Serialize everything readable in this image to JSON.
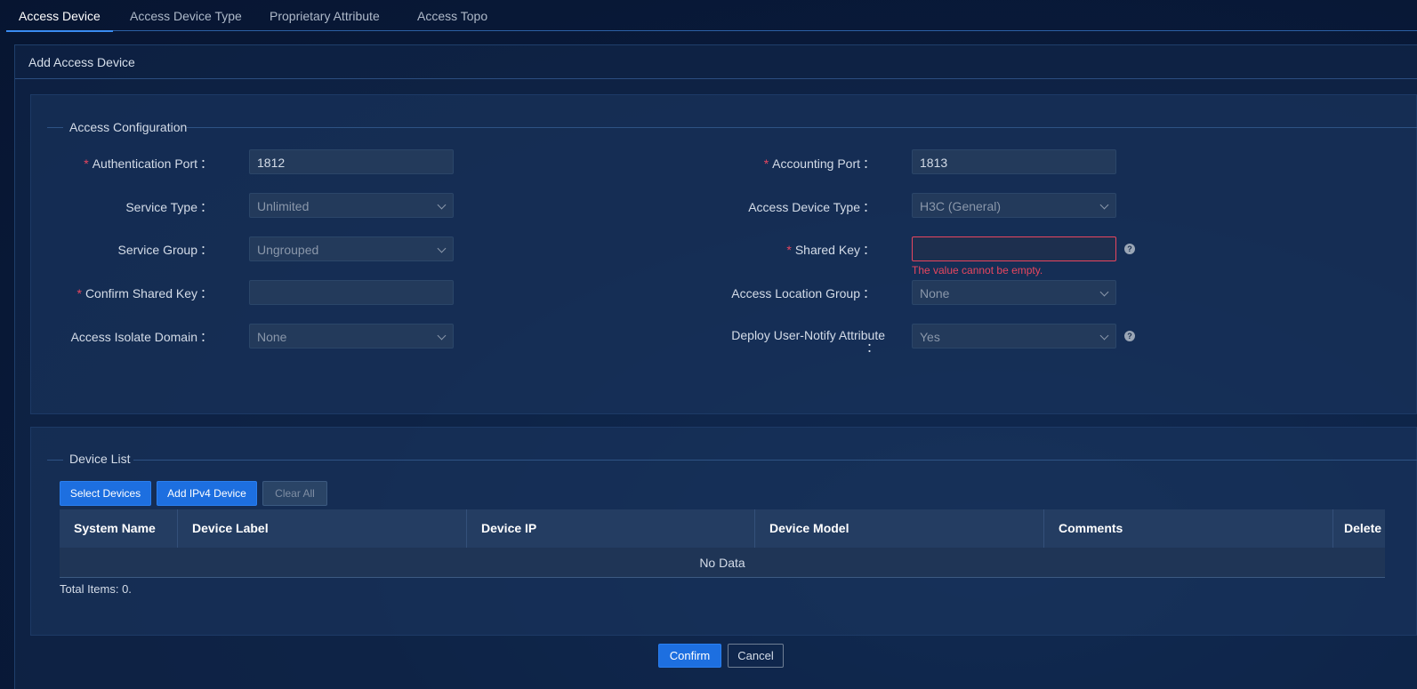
{
  "tabs": [
    {
      "label": "Access Device",
      "active": true
    },
    {
      "label": "Access Device Type",
      "active": false
    },
    {
      "label": "Proprietary Attribute",
      "active": false
    },
    {
      "label": "Access Topo",
      "active": false
    }
  ],
  "panel": {
    "title": "Add Access Device"
  },
  "access_config": {
    "legend": "Access Configuration",
    "auth_port": {
      "label": "Authentication Port",
      "value": "1812",
      "required": true
    },
    "accounting_port": {
      "label": "Accounting Port",
      "value": "1813",
      "required": true
    },
    "service_type": {
      "label": "Service Type",
      "value": "Unlimited"
    },
    "access_device_type": {
      "label": "Access Device Type",
      "value": "H3C (General)"
    },
    "service_group": {
      "label": "Service Group",
      "value": "Ungrouped"
    },
    "shared_key": {
      "label": "Shared Key",
      "value": "",
      "required": true,
      "error": "The value cannot be empty."
    },
    "confirm_shared_key": {
      "label": "Confirm Shared Key",
      "value": "",
      "required": true
    },
    "access_location_group": {
      "label": "Access Location Group",
      "value": "None"
    },
    "access_isolate_domain": {
      "label": "Access Isolate Domain",
      "value": "None"
    },
    "deploy_user_notify": {
      "label": "Deploy User-Notify Attribute",
      "value": "Yes"
    },
    "colon": "："
  },
  "device_list": {
    "legend": "Device List",
    "buttons": {
      "select": "Select Devices",
      "add_ipv4": "Add IPv4 Device",
      "clear_all": "Clear All"
    },
    "columns": [
      "System Name",
      "Device Label",
      "Device IP",
      "Device Model",
      "Comments",
      "Delete"
    ],
    "empty_text": "No Data",
    "total": "Total Items: 0."
  },
  "footer": {
    "confirm": "Confirm",
    "cancel": "Cancel"
  },
  "help_glyph": "?",
  "required_mark": "*",
  "colors": {
    "accent": "#1d6fe0",
    "error": "#e8465f",
    "background": "#0a1c3d"
  }
}
